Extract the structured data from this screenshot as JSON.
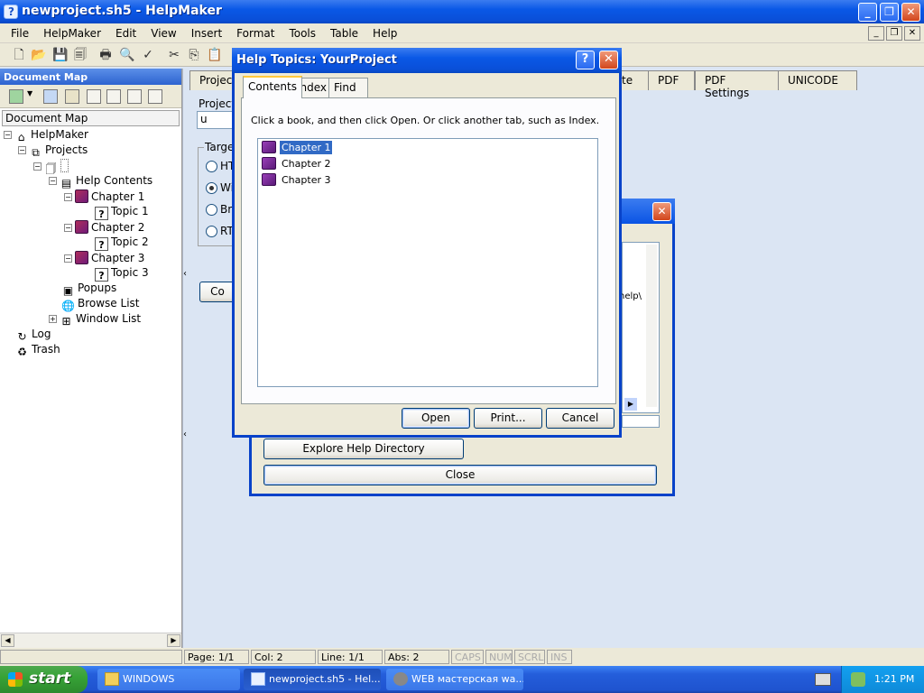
{
  "window": {
    "title": "newproject.sh5 - HelpMaker",
    "minimize": "_",
    "restore": "❐",
    "close": "✕"
  },
  "menu": {
    "file": "File",
    "helpmaker": "HelpMaker",
    "edit": "Edit",
    "view": "View",
    "insert": "Insert",
    "format": "Format",
    "tools": "Tools",
    "table": "Table",
    "help": "Help"
  },
  "left_pane": {
    "title": "Document Map",
    "doc_label": "Document Map",
    "tree": {
      "helpmaker": "HelpMaker",
      "projects": "Projects",
      "help_contents": "Help Contents",
      "chapter1": "Chapter 1",
      "topic1": "Topic 1",
      "chapter2": "Chapter 2",
      "topic2": "Topic 2",
      "chapter3": "Chapter 3",
      "topic3": "Topic 3",
      "popups": "Popups",
      "browse_list": "Browse List",
      "window_list": "Window List",
      "log": "Log",
      "trash": "Trash"
    }
  },
  "content": {
    "tabs": {
      "project": "Project",
      "te": "te",
      "pdf": "PDF",
      "pdf_settings": "PDF Settings",
      "unicode": "UNICODE"
    },
    "project_label": "Project",
    "project_value": "u",
    "target_label": "Targe",
    "radios": [
      "HT",
      "Wi",
      "Bro",
      "RT"
    ],
    "compile_btn": "Co"
  },
  "dialog_back": {
    "partial_text": "help\\",
    "explore_btn": "Explore Help Directory",
    "close_btn": "Close"
  },
  "dialog": {
    "title": "Help Topics: YourProject",
    "help_btn": "?",
    "close_btn": "✕",
    "tabs": {
      "contents": "Contents",
      "index": "Index",
      "find": "Find"
    },
    "instructions": "Click a book, and then click Open. Or click another tab, such as Index.",
    "items": [
      "Chapter 1",
      "Chapter 2",
      "Chapter 3"
    ],
    "buttons": {
      "open": "Open",
      "print": "Print...",
      "cancel": "Cancel"
    }
  },
  "status": {
    "page": "Page: 1/1",
    "col": "Col: 2",
    "line": "Line: 1/1",
    "abs": "Abs: 2",
    "caps": "CAPS",
    "num": "NUM",
    "scrl": "SCRL",
    "ins": "INS"
  },
  "taskbar": {
    "start": "start",
    "tasks": [
      "WINDOWS",
      "newproject.sh5 - Hel...",
      "WEB мастерская wa..."
    ],
    "time": "1:21 PM"
  },
  "colors": {
    "xp_blue": "#0a58e6",
    "selection": "#316ac5",
    "start_green": "#37a337"
  }
}
